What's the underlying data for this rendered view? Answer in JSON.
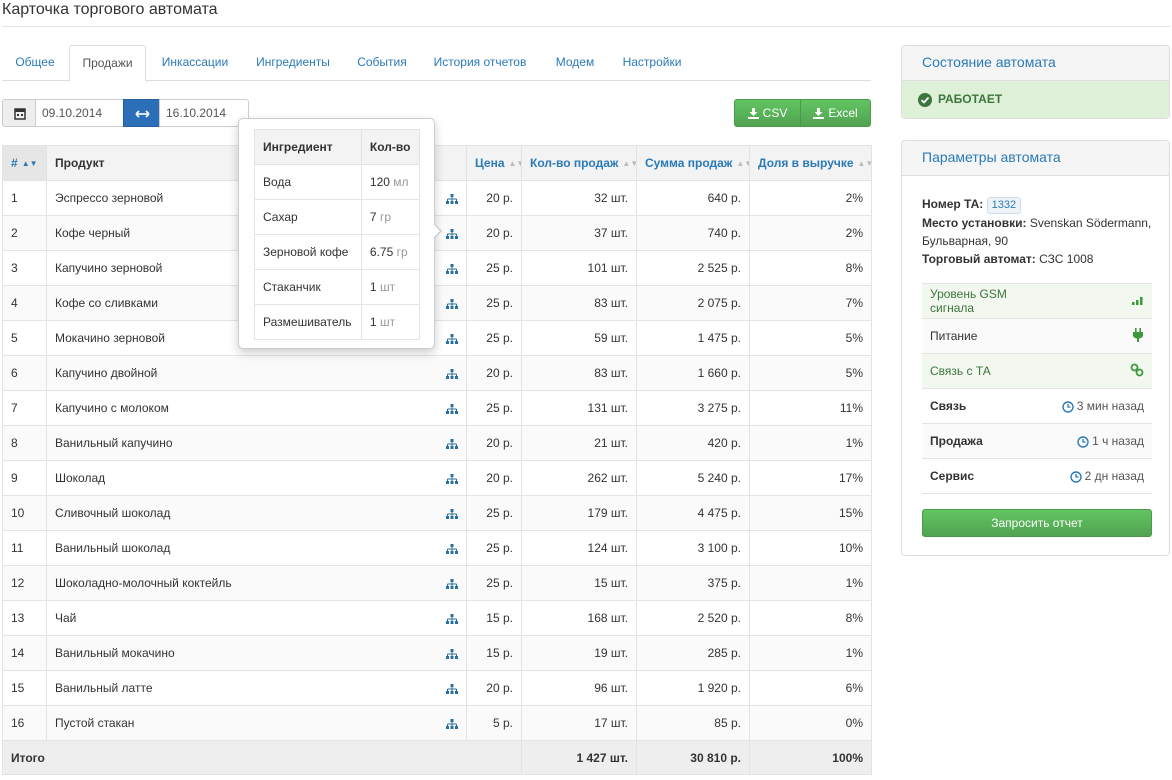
{
  "page": {
    "title": "Карточка торгового автомата"
  },
  "tabs": [
    {
      "label": "Общее"
    },
    {
      "label": "Продажи"
    },
    {
      "label": "Инкассации"
    },
    {
      "label": "Ингредиенты"
    },
    {
      "label": "События"
    },
    {
      "label": "История отчетов"
    },
    {
      "label": "Модем"
    },
    {
      "label": "Настройки"
    }
  ],
  "active_tab": "Продажи",
  "date_range": {
    "from": "09.10.2014",
    "to": "16.10.2014"
  },
  "export": {
    "csv": "CSV",
    "excel": "Excel"
  },
  "table": {
    "columns": [
      "#",
      "Продукт",
      "Цена",
      "Кол-во продаж",
      "Сумма продаж",
      "Доля в выручке"
    ],
    "rows": [
      {
        "n": "1",
        "product": "Эспрессо зерновой",
        "price": "20 р.",
        "qty": "32 шт.",
        "sum": "640 р.",
        "share": "2%"
      },
      {
        "n": "2",
        "product": "Кофе черный",
        "price": "20 р.",
        "qty": "37 шт.",
        "sum": "740 р.",
        "share": "2%"
      },
      {
        "n": "3",
        "product": "Капучино зерновой",
        "price": "25 р.",
        "qty": "101 шт.",
        "sum": "2 525 р.",
        "share": "8%"
      },
      {
        "n": "4",
        "product": "Кофе со сливками",
        "price": "25 р.",
        "qty": "83 шт.",
        "sum": "2 075 р.",
        "share": "7%"
      },
      {
        "n": "5",
        "product": "Мокачино зерновой",
        "price": "25 р.",
        "qty": "59 шт.",
        "sum": "1 475 р.",
        "share": "5%"
      },
      {
        "n": "6",
        "product": "Капучино двойной",
        "price": "20 р.",
        "qty": "83 шт.",
        "sum": "1 660 р.",
        "share": "5%"
      },
      {
        "n": "7",
        "product": "Капучино с молоком",
        "price": "25 р.",
        "qty": "131 шт.",
        "sum": "3 275 р.",
        "share": "11%"
      },
      {
        "n": "8",
        "product": "Ванильный капучино",
        "price": "20 р.",
        "qty": "21 шт.",
        "sum": "420 р.",
        "share": "1%"
      },
      {
        "n": "9",
        "product": "Шоколад",
        "price": "20 р.",
        "qty": "262 шт.",
        "sum": "5 240 р.",
        "share": "17%"
      },
      {
        "n": "10",
        "product": "Сливочный шоколад",
        "price": "25 р.",
        "qty": "179 шт.",
        "sum": "4 475 р.",
        "share": "15%"
      },
      {
        "n": "11",
        "product": "Ванильный шоколад",
        "price": "25 р.",
        "qty": "124 шт.",
        "sum": "3 100 р.",
        "share": "10%"
      },
      {
        "n": "12",
        "product": "Шоколадно-молочный коктейль",
        "price": "25 р.",
        "qty": "15 шт.",
        "sum": "375 р.",
        "share": "1%"
      },
      {
        "n": "13",
        "product": "Чай",
        "price": "15 р.",
        "qty": "168 шт.",
        "sum": "2 520 р.",
        "share": "8%"
      },
      {
        "n": "14",
        "product": "Ванильный мокачино",
        "price": "15 р.",
        "qty": "19 шт.",
        "sum": "285 р.",
        "share": "1%"
      },
      {
        "n": "15",
        "product": "Ванильный латте",
        "price": "20 р.",
        "qty": "96 шт.",
        "sum": "1 920 р.",
        "share": "6%"
      },
      {
        "n": "16",
        "product": "Пустой стакан",
        "price": "5 р.",
        "qty": "17 шт.",
        "sum": "85 р.",
        "share": "0%"
      }
    ],
    "total": {
      "label": "Итого",
      "qty": "1 427 шт.",
      "sum": "30 810 р.",
      "share": "100%"
    }
  },
  "popover": {
    "columns": [
      "Ингредиент",
      "Кол-во"
    ],
    "rows": [
      {
        "name": "Вода",
        "amount": "120",
        "unit": "мл"
      },
      {
        "name": "Сахар",
        "amount": "7",
        "unit": "гр"
      },
      {
        "name": "Зерновой кофе",
        "amount": "6.75",
        "unit": "гр"
      },
      {
        "name": "Стаканчик",
        "amount": "1",
        "unit": "шт"
      },
      {
        "name": "Размешиватель",
        "amount": "1",
        "unit": "шт"
      }
    ]
  },
  "status_panel": {
    "title": "Состояние автомата",
    "status": "РАБОТАЕТ"
  },
  "params_panel": {
    "title": "Параметры автомата",
    "ta_label": "Номер ТА:",
    "ta_value": "1332",
    "place_label": "Место установки:",
    "place_value": "Svenskan Södermann, Бульварная, 90",
    "machine_label": "Торговый автомат:",
    "machine_value": "СЗС 1008",
    "indicators": [
      {
        "label": "Уровень GSM сигнала",
        "icon": "signal-icon"
      },
      {
        "label": "Питание",
        "icon": "plug-icon"
      },
      {
        "label": "Связь с ТА",
        "icon": "link-icon"
      }
    ],
    "times": [
      {
        "label": "Связь",
        "value": "3 мин назад"
      },
      {
        "label": "Продажа",
        "value": "1 ч назад"
      },
      {
        "label": "Сервис",
        "value": "2 дн назад"
      }
    ],
    "request_button": "Запросить отчет"
  },
  "colors": {
    "link": "#2a7ab8",
    "green": "#5cb85c",
    "status_bg": "#dff0d8",
    "status_text": "#3c763d"
  }
}
